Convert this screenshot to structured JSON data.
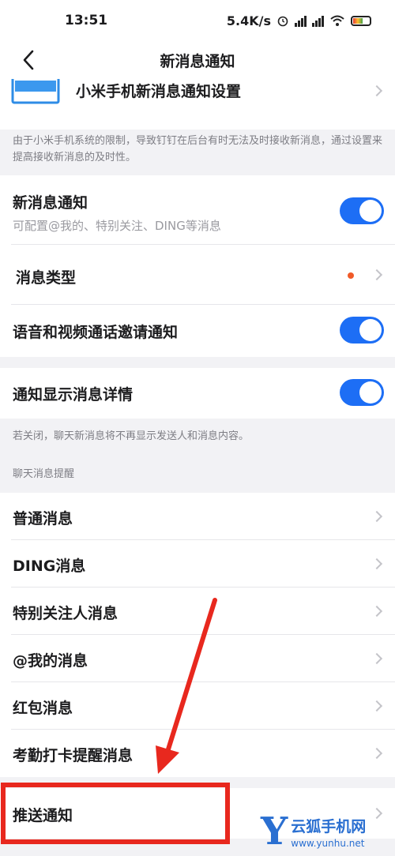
{
  "status_bar": {
    "time": "13:51",
    "network_speed": "5.4K/s",
    "alarm_icon": "alarm-icon",
    "signal_icon": "signal-icon",
    "wifi_icon": "wifi-icon",
    "battery_icon": "battery-icon"
  },
  "nav": {
    "title": "新消息通知",
    "back_icon": "chevron-left-icon"
  },
  "xiaomi_row": {
    "label": "小米手机新消息通知设置"
  },
  "xiaomi_note": "由于小米手机系统的限制，导致钉钉在后台有时无法及时接收新消息，通过设置来提高接收新消息的及时性。",
  "new_msg": {
    "label": "新消息通知",
    "sub": "可配置@我的、特别关注、DING等消息",
    "enabled": true
  },
  "msg_type": {
    "label": "消息类型",
    "dot_color": "#f05a28"
  },
  "call_invite": {
    "label": "语音和视频通话邀请通知",
    "enabled": true
  },
  "show_detail": {
    "label": "通知显示消息详情",
    "enabled": true
  },
  "show_detail_note": "若关闭，聊天新消息将不再显示发送人和消息内容。",
  "chat_section_title": "聊天消息提醒",
  "chat_items": [
    {
      "label": "普通消息"
    },
    {
      "label": "DING消息"
    },
    {
      "label": "特别关注人消息"
    },
    {
      "label": "@我的消息"
    },
    {
      "label": "红包消息"
    },
    {
      "label": "考勤打卡提醒消息"
    }
  ],
  "push_row": {
    "label": "推送通知"
  },
  "annotation": {
    "color": "#e8281e"
  },
  "watermark": {
    "logo": "Y",
    "name": "云狐手机网",
    "url": "www.yunhu.net"
  },
  "colors": {
    "accent": "#1d6ef5",
    "background": "#f2f2f5"
  }
}
